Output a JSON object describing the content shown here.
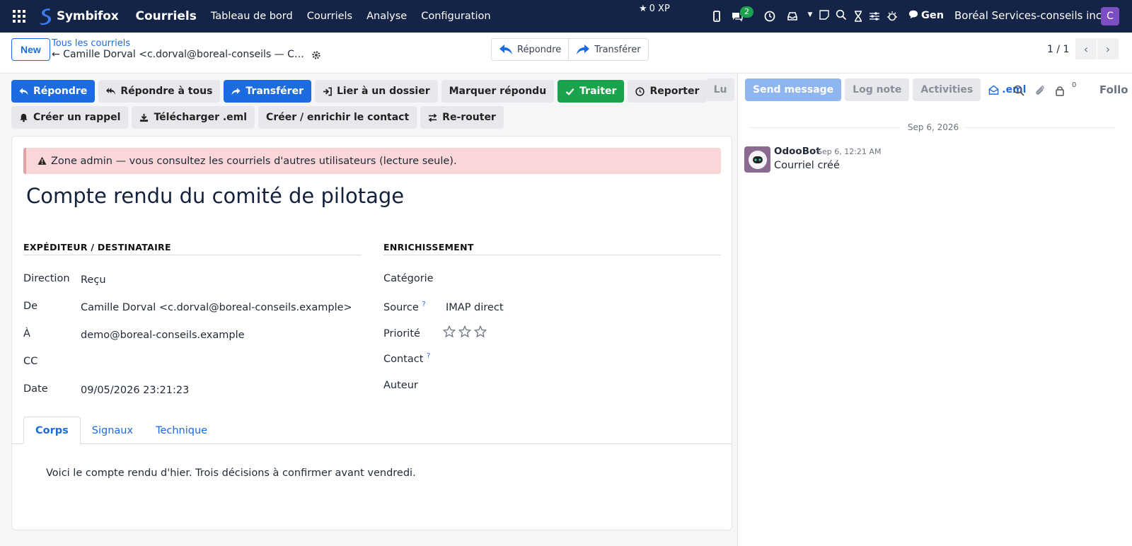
{
  "navbar": {
    "brand": "Symbifox",
    "app": "Courriels",
    "menu": [
      "Tableau de bord",
      "Courriels",
      "Analyse",
      "Configuration"
    ],
    "xp": "0 XP",
    "messages_badge": "2",
    "gen": "Gen",
    "company": "Boréal Services-conseils inc.",
    "avatar": "C",
    "bg_color": "#142446"
  },
  "control": {
    "new_label": "New",
    "breadcrumb": "Tous les courriels",
    "record_title": "← Camille Dorval <c.dorval@boreal-conseils — Compte rendu du comité de pilotage",
    "reply_label": "Répondre",
    "forward_label": "Transférer",
    "pager": "1 / 1"
  },
  "actions": {
    "row1": [
      {
        "label": "Répondre",
        "style": "primary",
        "icon": "reply-icon"
      },
      {
        "label": "Répondre à tous",
        "style": "default",
        "icon": "reply-all-icon"
      },
      {
        "label": "Transférer",
        "style": "primary",
        "icon": "forward-icon"
      },
      {
        "label": "Lier à un dossier",
        "style": "default",
        "icon": "sign-in-icon"
      },
      {
        "label": "Marquer répondu",
        "style": "default",
        "icon": ""
      },
      {
        "label": "Traiter",
        "style": "success",
        "icon": "check-icon"
      },
      {
        "label": "Reporter",
        "style": "default",
        "icon": "clock-icon"
      }
    ],
    "row2": [
      {
        "label": "Créer un rappel",
        "icon": "bell-icon"
      },
      {
        "label": "Télécharger .eml",
        "icon": "download-icon"
      },
      {
        "label": "Créer / enrichir le contact",
        "icon": ""
      },
      {
        "label": "Re-router",
        "icon": "exchange-icon"
      }
    ]
  },
  "form": {
    "alert": "Zone admin — vous consultez les courriels d'autres utilisateurs (lecture seule).",
    "subject": "Compte rendu du comité de pilotage",
    "left_section": "EXPÉDITEUR / DESTINATAIRE",
    "right_section": "ENRICHISSEMENT",
    "fields_left": [
      {
        "label": "Direction",
        "value": "Reçu"
      },
      {
        "label": "De",
        "value": "Camille Dorval <c.dorval@boreal-conseils.example>"
      },
      {
        "label": "À",
        "value": "demo@boreal-conseils.example"
      },
      {
        "label": "CC",
        "value": ""
      },
      {
        "label": "Date",
        "value": "09/05/2026 23:21:23"
      }
    ],
    "fields_right": {
      "categorie": {
        "label": "Catégorie",
        "value": ""
      },
      "source": {
        "label": "Source",
        "help": "?",
        "value": "IMAP direct"
      },
      "priorite": {
        "label": "Priorité",
        "stars": 0,
        "max": 3
      },
      "contact": {
        "label": "Contact",
        "help": "?",
        "value": ""
      },
      "auteur": {
        "label": "Auteur",
        "value": ""
      }
    },
    "tabs": [
      "Corps",
      "Signaux",
      "Technique"
    ],
    "active_tab": "Corps",
    "body": "Voici le compte rendu d'hier. Trois décisions à confirmer avant vendredi."
  },
  "chatter": {
    "partial_button": "Lu",
    "send_message": "Send message",
    "log_note": "Log note",
    "activities": "Activities",
    "eml": ".eml",
    "followers_count": "0",
    "follow": "Follo",
    "date": "Sep 6, 2026",
    "messages": [
      {
        "author": "OdooBot",
        "time": "Sep 6, 12:21 AM",
        "body": "Courriel créé"
      }
    ]
  }
}
